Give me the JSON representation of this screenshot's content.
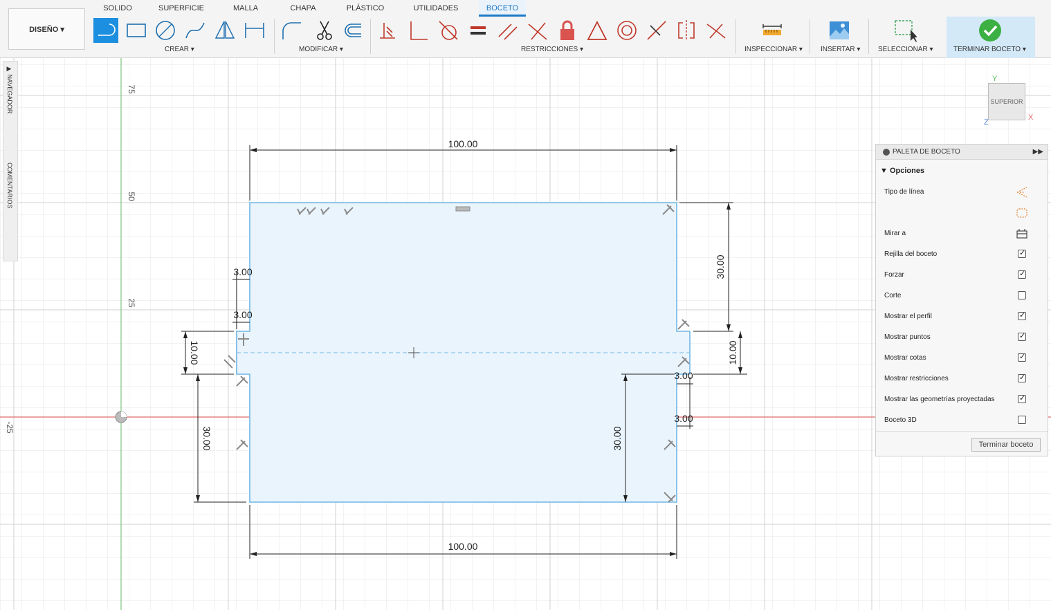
{
  "tabs": [
    {
      "label": "SOLIDO"
    },
    {
      "label": "SUPERFICIE"
    },
    {
      "label": "MALLA"
    },
    {
      "label": "CHAPA"
    },
    {
      "label": "PLÁSTICO"
    },
    {
      "label": "UTILIDADES"
    },
    {
      "label": "BOCETO",
      "active": true
    }
  ],
  "workspace": {
    "label": "DISEÑO ▾"
  },
  "groups": {
    "crear": "CREAR ▾",
    "modificar": "MODIFICAR ▾",
    "restricciones": "RESTRICCIONES ▾",
    "inspeccionar": "INSPECCIONAR ▾",
    "insertar": "INSERTAR ▾",
    "seleccionar": "SELECCIONAR ▾",
    "terminar": "TERMINAR BOCETO ▾"
  },
  "side_panel": {
    "navegador": "▶ NAVEGADOR",
    "comentarios": "COMENTARIOS"
  },
  "viewcube": {
    "face": "SUPERIOR",
    "axis_x": "X",
    "axis_y": "Y",
    "axis_z": "Z"
  },
  "axis_ticks": {
    "t75": "75",
    "t50": "50",
    "t25": "25",
    "tm25": "-25"
  },
  "dimensions": {
    "top_width": "100.00",
    "bottom_width": "100.00",
    "left_offset_a": "3.00",
    "left_offset_b": "3.00",
    "left_height_10": "10.00",
    "left_height_30": "30.00",
    "right_height_30_top": "30.00",
    "right_height_10": "10.00",
    "right_offset_a": "3.00",
    "right_offset_b": "3.00",
    "right_height_30_bottom": "30.00"
  },
  "palette": {
    "title": "PALETA DE BOCETO",
    "section": "Opciones",
    "rows": [
      {
        "label": "Tipo de línea",
        "type": "icon"
      },
      {
        "label": "",
        "type": "icon"
      },
      {
        "label": "Mirar a",
        "type": "icon"
      },
      {
        "label": "Rejilla del boceto",
        "checked": true
      },
      {
        "label": "Forzar",
        "checked": true
      },
      {
        "label": "Corte",
        "checked": false
      },
      {
        "label": "Mostrar el perfil",
        "checked": true
      },
      {
        "label": "Mostrar puntos",
        "checked": true
      },
      {
        "label": "Mostrar cotas",
        "checked": true
      },
      {
        "label": "Mostrar restricciones",
        "checked": true
      },
      {
        "label": "Mostrar las geometrías proyectadas",
        "checked": true
      },
      {
        "label": "Boceto 3D",
        "checked": false
      }
    ],
    "finish_button": "Terminar boceto"
  },
  "colors": {
    "accent": "#1d8fe1",
    "sketch_fill": "#eaf4fc",
    "sketch_line": "#6fb6e4",
    "x_axis": "#e06a6a",
    "y_axis": "#7cc47c"
  }
}
